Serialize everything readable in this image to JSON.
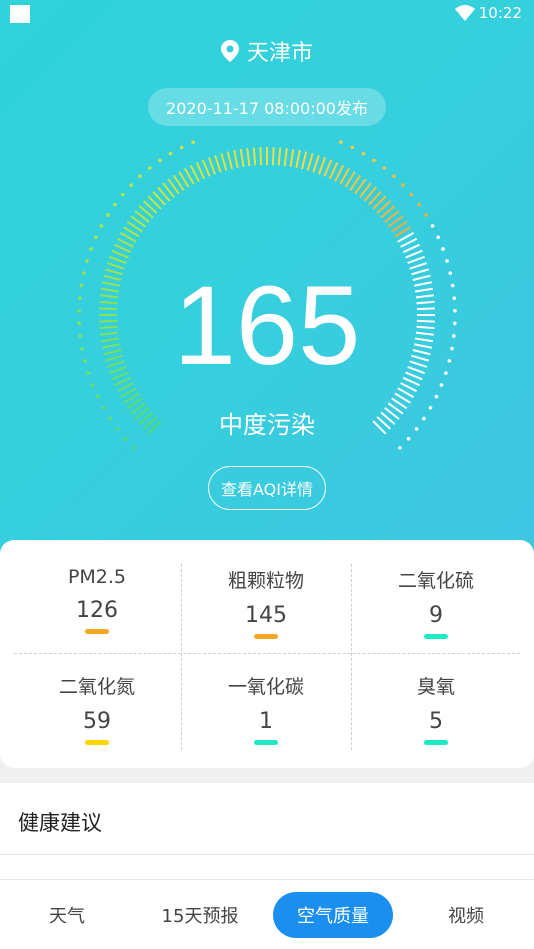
{
  "status_bar": {
    "time": "10:22"
  },
  "location": {
    "city": "天津市"
  },
  "publish_time": "2020-11-17 08:00:00发布",
  "aqi": {
    "value": "165",
    "level": "中度污染",
    "detail_button": "查看AQI详情"
  },
  "pollutants": [
    {
      "name": "PM2.5",
      "value": "126",
      "color": "#f5a623"
    },
    {
      "name": "粗颗粒物",
      "value": "145",
      "color": "#f5a623"
    },
    {
      "name": "二氧化硫",
      "value": "9",
      "color": "#1de9c4"
    },
    {
      "name": "二氧化氮",
      "value": "59",
      "color": "#ffd500"
    },
    {
      "name": "一氧化碳",
      "value": "1",
      "color": "#1de9c4"
    },
    {
      "name": "臭氧",
      "value": "5",
      "color": "#1de9c4"
    }
  ],
  "health": {
    "title": "健康建议"
  },
  "tabs": [
    {
      "label": "天气",
      "active": false
    },
    {
      "label": "15天预报",
      "active": false
    },
    {
      "label": "空气质量",
      "active": true
    },
    {
      "label": "视频",
      "active": false
    }
  ],
  "colors": {
    "accent": "#1a8ff0",
    "hero_start": "#2fd3d9",
    "hero_end": "#3ec6e2"
  }
}
